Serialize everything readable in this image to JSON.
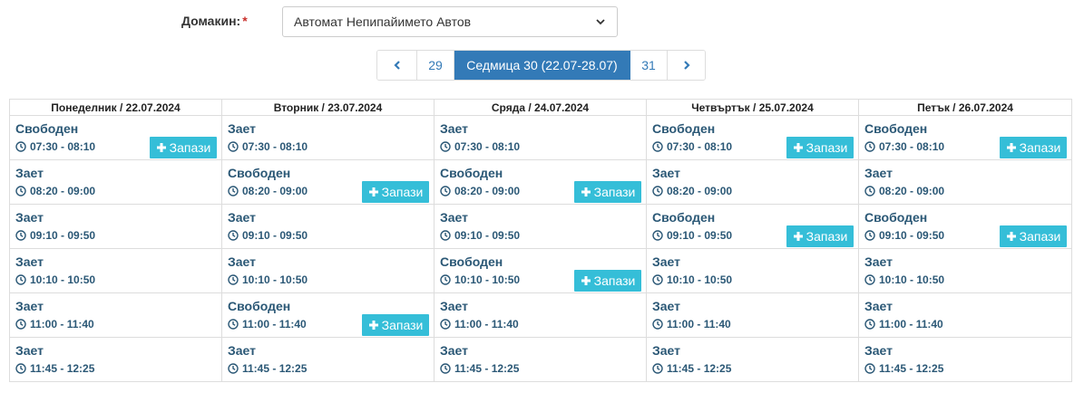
{
  "host": {
    "label": "Домакин:",
    "required_mark": "*",
    "selected": "Автомат Непипайимето Автов"
  },
  "pager": {
    "prev_icon": "chevron-left-icon",
    "prev_week": "29",
    "current_week": "Седмица 30 (22.07-28.07)",
    "next_week": "31",
    "next_icon": "chevron-right-icon"
  },
  "colors": {
    "accent": "#337ab7",
    "book_button": "#35bed8",
    "slot_text": "#2b5876"
  },
  "book_label": "Запази",
  "days": [
    {
      "header": "Понеделник / 22.07.2024",
      "slots": [
        {
          "status": "Свободен",
          "time": "07:30 - 08:10",
          "free": true
        },
        {
          "status": "Зает",
          "time": "08:20 - 09:00",
          "free": false
        },
        {
          "status": "Зает",
          "time": "09:10 - 09:50",
          "free": false
        },
        {
          "status": "Зает",
          "time": "10:10 - 10:50",
          "free": false
        },
        {
          "status": "Зает",
          "time": "11:00 - 11:40",
          "free": false
        },
        {
          "status": "Зает",
          "time": "11:45 - 12:25",
          "free": false
        }
      ]
    },
    {
      "header": "Вторник / 23.07.2024",
      "slots": [
        {
          "status": "Зает",
          "time": "07:30 - 08:10",
          "free": false
        },
        {
          "status": "Свободен",
          "time": "08:20 - 09:00",
          "free": true
        },
        {
          "status": "Зает",
          "time": "09:10 - 09:50",
          "free": false
        },
        {
          "status": "Зает",
          "time": "10:10 - 10:50",
          "free": false
        },
        {
          "status": "Свободен",
          "time": "11:00 - 11:40",
          "free": true
        },
        {
          "status": "Зает",
          "time": "11:45 - 12:25",
          "free": false
        }
      ]
    },
    {
      "header": "Сряда / 24.07.2024",
      "slots": [
        {
          "status": "Зает",
          "time": "07:30 - 08:10",
          "free": false
        },
        {
          "status": "Свободен",
          "time": "08:20 - 09:00",
          "free": true
        },
        {
          "status": "Зает",
          "time": "09:10 - 09:50",
          "free": false
        },
        {
          "status": "Свободен",
          "time": "10:10 - 10:50",
          "free": true
        },
        {
          "status": "Зает",
          "time": "11:00 - 11:40",
          "free": false
        },
        {
          "status": "Зает",
          "time": "11:45 - 12:25",
          "free": false
        }
      ]
    },
    {
      "header": "Четвъртък / 25.07.2024",
      "slots": [
        {
          "status": "Свободен",
          "time": "07:30 - 08:10",
          "free": true
        },
        {
          "status": "Зает",
          "time": "08:20 - 09:00",
          "free": false
        },
        {
          "status": "Свободен",
          "time": "09:10 - 09:50",
          "free": true
        },
        {
          "status": "Зает",
          "time": "10:10 - 10:50",
          "free": false
        },
        {
          "status": "Зает",
          "time": "11:00 - 11:40",
          "free": false
        },
        {
          "status": "Зает",
          "time": "11:45 - 12:25",
          "free": false
        }
      ]
    },
    {
      "header": "Петък / 26.07.2024",
      "slots": [
        {
          "status": "Свободен",
          "time": "07:30 - 08:10",
          "free": true
        },
        {
          "status": "Зает",
          "time": "08:20 - 09:00",
          "free": false
        },
        {
          "status": "Свободен",
          "time": "09:10 - 09:50",
          "free": true
        },
        {
          "status": "Зает",
          "time": "10:10 - 10:50",
          "free": false
        },
        {
          "status": "Зает",
          "time": "11:00 - 11:40",
          "free": false
        },
        {
          "status": "Зает",
          "time": "11:45 - 12:25",
          "free": false
        }
      ]
    }
  ]
}
